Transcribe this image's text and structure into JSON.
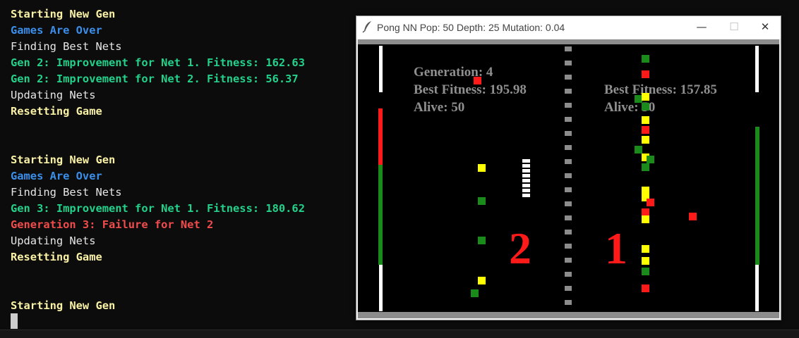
{
  "terminal": {
    "lines": [
      {
        "text": "Starting New Gen",
        "color": "yellow"
      },
      {
        "text": "Games Are Over",
        "color": "blue"
      },
      {
        "text": "Finding Best Nets",
        "color": "white"
      },
      {
        "text": "Gen 2: Improvement for Net 1. Fitness: 162.63",
        "color": "green"
      },
      {
        "text": "Gen 2: Improvement for Net 2. Fitness: 56.37",
        "color": "green"
      },
      {
        "text": "Updating Nets",
        "color": "white"
      },
      {
        "text": "Resetting Game",
        "color": "yellow"
      },
      {
        "text": "",
        "color": "white"
      },
      {
        "text": "",
        "color": "white"
      },
      {
        "text": "Starting New Gen",
        "color": "yellow"
      },
      {
        "text": "Games Are Over",
        "color": "blue"
      },
      {
        "text": "Finding Best Nets",
        "color": "white"
      },
      {
        "text": "Gen 3: Improvement for Net 1. Fitness: 180.62",
        "color": "green"
      },
      {
        "text": "Generation 3: Failure for Net 2",
        "color": "red"
      },
      {
        "text": "Updating Nets",
        "color": "white"
      },
      {
        "text": "Resetting Game",
        "color": "yellow"
      },
      {
        "text": "",
        "color": "white"
      },
      {
        "text": "",
        "color": "white"
      },
      {
        "text": "Starting New Gen",
        "color": "yellow"
      }
    ]
  },
  "window": {
    "title": "Pong NN Pop: 50 Depth: 25 Mutation: 0.04",
    "icon": "feather-icon",
    "minimize": "—",
    "maximize": "☐",
    "close": "✕"
  },
  "game": {
    "left_hud": {
      "generation": "Generation: 4",
      "best_fitness": "Best Fitness: 195.98",
      "alive": "Alive: 50"
    },
    "right_hud": {
      "best_fitness": "Best Fitness: 157.85",
      "alive": "Alive: 50"
    },
    "left_score": "2",
    "right_score": "1",
    "colors": {
      "ball_yellow": "#ffff00",
      "ball_green": "#1a8a1a",
      "ball_red": "#ff1a1a",
      "paddle_red": "#ff1a1a",
      "paddle_green": "#1a8a1a"
    }
  }
}
